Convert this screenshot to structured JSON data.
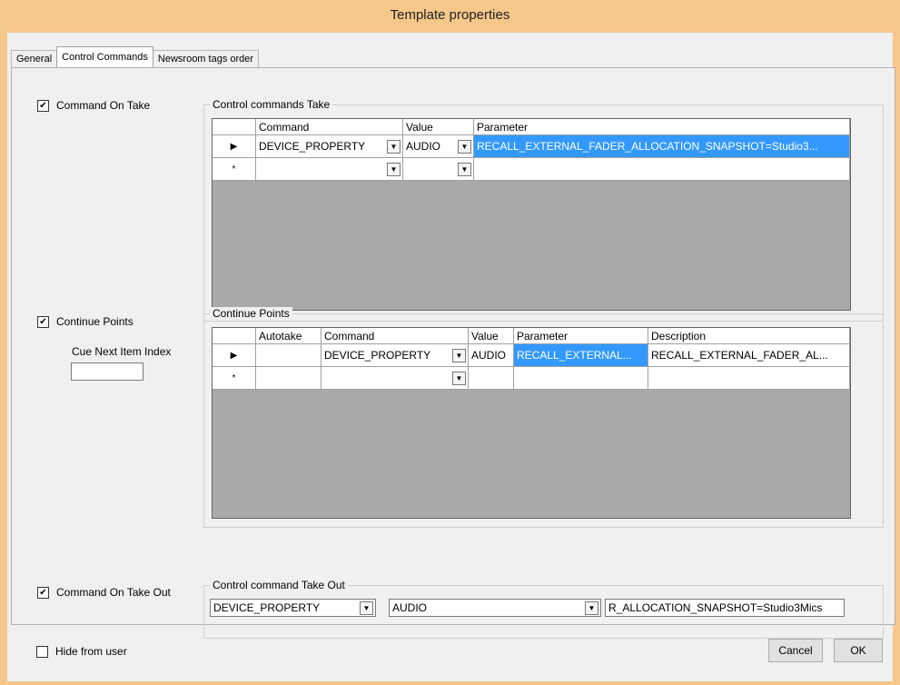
{
  "window": {
    "title": "Template properties"
  },
  "tabs": [
    {
      "label": "General"
    },
    {
      "label": "Control Commands"
    },
    {
      "label": "Newsroom tags order"
    }
  ],
  "command_on_take": {
    "checkbox_label": "Command On Take",
    "checked": true,
    "group_title": "Control commands Take",
    "columns": [
      "Command",
      "Value",
      "Parameter"
    ],
    "rows": [
      {
        "marker": "▶",
        "command": "DEVICE_PROPERTY",
        "value": "AUDIO",
        "parameter": "RECALL_EXTERNAL_FADER_ALLOCATION_SNAPSHOT=Studio3..."
      },
      {
        "marker": "*",
        "command": "",
        "value": "",
        "parameter": ""
      }
    ]
  },
  "continue_points": {
    "checkbox_label": "Continue Points",
    "checked": true,
    "cue_label": "Cue Next Item Index",
    "cue_value": "",
    "group_title": "Continue Points",
    "columns": [
      "Autotake",
      "Command",
      "Value",
      "Parameter",
      "Description"
    ],
    "rows": [
      {
        "marker": "▶",
        "autotake": "",
        "command": "DEVICE_PROPERTY",
        "value": "AUDIO",
        "parameter": "RECALL_EXTERNAL...",
        "description": "RECALL_EXTERNAL_FADER_AL..."
      },
      {
        "marker": "*",
        "autotake": "",
        "command": "",
        "value": "",
        "parameter": "",
        "description": ""
      }
    ]
  },
  "command_on_take_out": {
    "checkbox_label": "Command On Take Out",
    "checked": true,
    "group_title": "Control command Take Out",
    "command": "DEVICE_PROPERTY",
    "value": "AUDIO",
    "parameter": "R_ALLOCATION_SNAPSHOT=Studio3Mics"
  },
  "footer": {
    "hide_label": "Hide from user",
    "hide_checked": false,
    "cancel_label": "Cancel",
    "ok_label": "OK"
  }
}
